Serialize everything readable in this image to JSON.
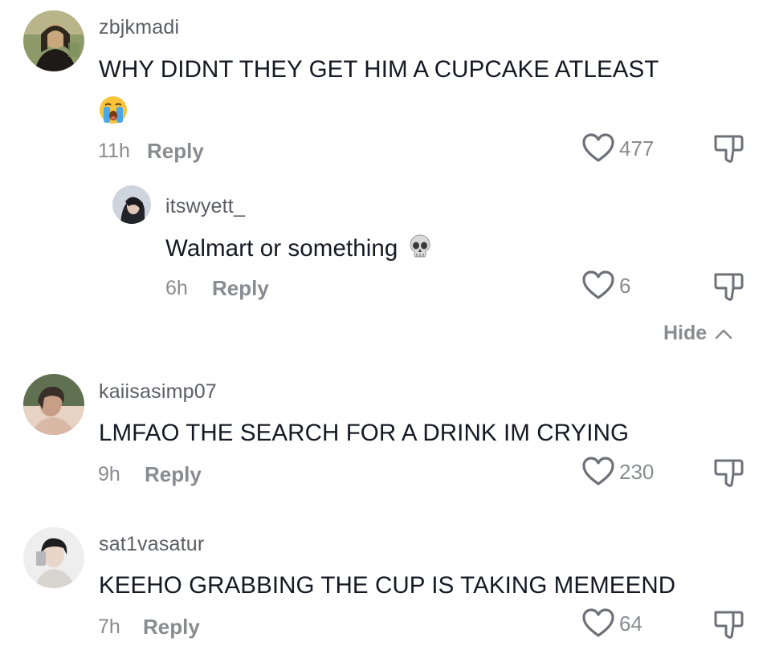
{
  "comments": [
    {
      "username": "zbjkmadi",
      "text": "WHY DIDNT THEY GET HIM A CUPCAKE ATLEAST",
      "emoji": "loudly-crying-face",
      "time": "11h",
      "reply_label": "Reply",
      "likes": "477",
      "avatar_colors": [
        "#c9a77c",
        "#3b3024",
        "#7b8f5c"
      ],
      "replies": [
        {
          "username": "itswyett_",
          "text": "Walmart or something",
          "emoji": "skull",
          "time": "6h",
          "reply_label": "Reply",
          "likes": "6",
          "avatar_colors": [
            "#d7dbe2",
            "#23232a",
            "#b7c3d4"
          ]
        }
      ],
      "hide_label": "Hide"
    },
    {
      "username": "kaiisasimp07",
      "text": "LMFAO THE SEARCH FOR A DRINK IM CRYING",
      "time": "9h",
      "reply_label": "Reply",
      "likes": "230",
      "avatar_colors": [
        "#c89f86",
        "#3a2e28",
        "#e7d3c4"
      ]
    },
    {
      "username": "sat1vasatur",
      "text": "KEEHO GRABBING THE CUP IS TAKING MEMEEND",
      "time": "7h",
      "reply_label": "Reply",
      "likes": "64",
      "avatar_colors": [
        "#e9e9ea",
        "#1f1d1f",
        "#c9b7a8"
      ]
    }
  ],
  "colors": {
    "text_primary": "#161823",
    "text_secondary": "#8a8b91",
    "username": "#5c5d66",
    "icon_stroke": "#6f7078"
  }
}
